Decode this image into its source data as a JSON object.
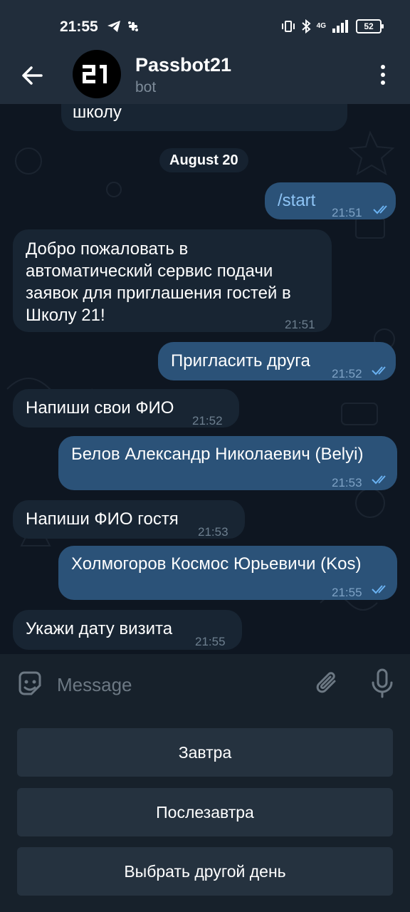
{
  "status_bar": {
    "time": "21:55",
    "network": "4G",
    "battery": "52"
  },
  "header": {
    "bot_name": "Passbot21",
    "bot_status": "bot"
  },
  "chat": {
    "date_label": "August 20",
    "messages": [
      {
        "direction": "in",
        "text": "школу",
        "time": ""
      },
      {
        "direction": "out",
        "text": "/start",
        "time": "21:51"
      },
      {
        "direction": "in",
        "lines": [
          "Добро пожаловать в",
          "автоматический сервис подачи",
          "заявок для приглашения гостей в",
          "Школу 21!"
        ],
        "time": "21:51"
      },
      {
        "direction": "out",
        "text": "Пригласить друга",
        "time": "21:52"
      },
      {
        "direction": "in",
        "text": "Напиши свои ФИО",
        "time": "21:52"
      },
      {
        "direction": "out",
        "text": "Белов Александр Николаевич (Belyi)",
        "time": "21:53"
      },
      {
        "direction": "in",
        "text": "Напиши ФИО гостя",
        "time": "21:53"
      },
      {
        "direction": "out",
        "text": "Холмогоров Космос Юрьевичи (Kos)",
        "time": "21:55"
      },
      {
        "direction": "in",
        "text": "Укажи дату визита",
        "time": "21:55"
      }
    ]
  },
  "input": {
    "placeholder": "Message"
  },
  "keyboard": {
    "buttons": [
      "Завтра",
      "Послезавтра",
      "Выбрать другой день"
    ]
  },
  "colors": {
    "header_bg": "#212d3b",
    "chat_bg": "#0e1621",
    "incoming_bubble": "#182533",
    "outgoing_bubble": "#2b5278",
    "read_ticks": "#6ab2f2"
  },
  "icons": [
    "back-arrow-icon",
    "bot-avatar-icon",
    "more-vert-icon",
    "sticker-icon",
    "paperclip-icon",
    "microphone-icon",
    "double-check-icon"
  ]
}
